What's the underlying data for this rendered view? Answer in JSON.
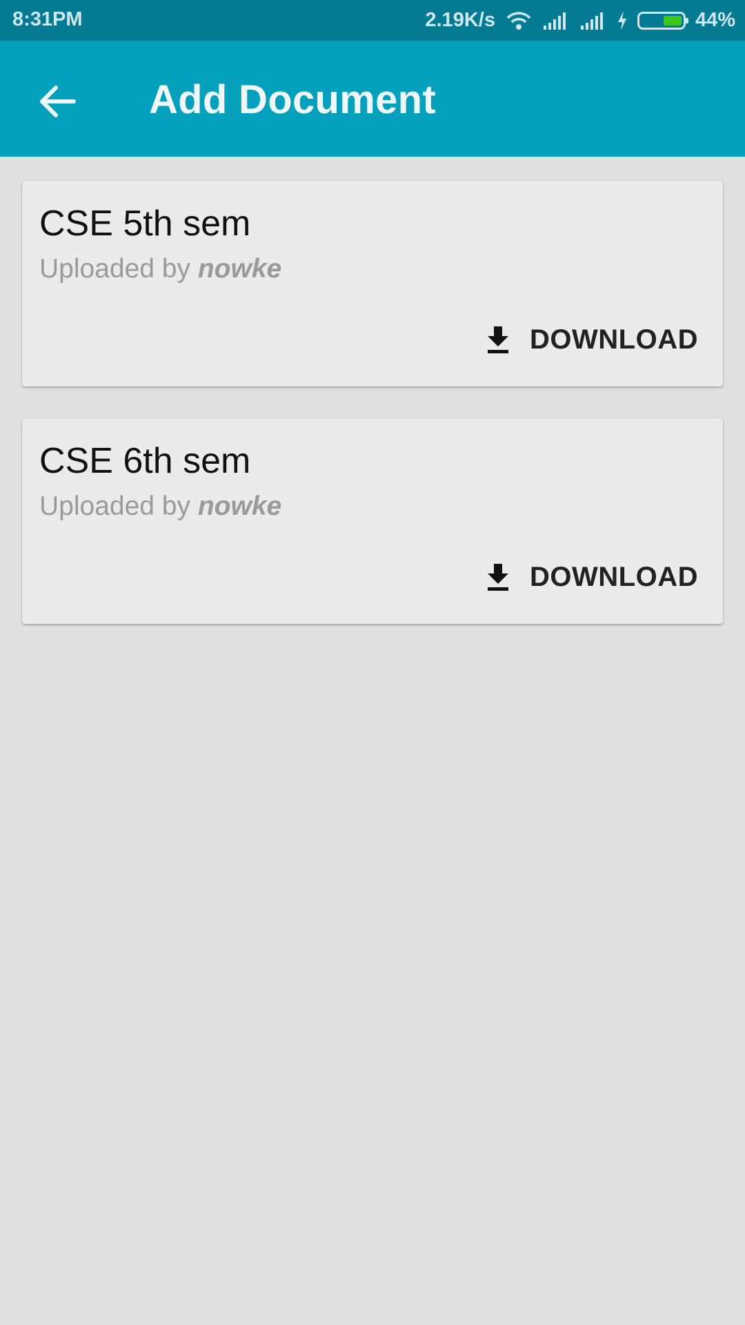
{
  "status_bar": {
    "time": "8:31PM",
    "speed": "2.19K/s",
    "battery_percent": "44%",
    "battery_level": 0.44,
    "battery_color": "#3ec51f"
  },
  "app_bar": {
    "title": "Add Document",
    "back_icon": "arrow-back-icon",
    "color": "#05a0bb"
  },
  "documents": [
    {
      "title": "CSE 5th sem",
      "uploaded_by_label": "Uploaded by",
      "uploader": "nowke",
      "download_label": "DOWNLOAD",
      "download_icon": "download-icon"
    },
    {
      "title": "CSE 6th sem",
      "uploaded_by_label": "Uploaded by",
      "uploader": "nowke",
      "download_label": "DOWNLOAD",
      "download_icon": "download-icon"
    }
  ]
}
